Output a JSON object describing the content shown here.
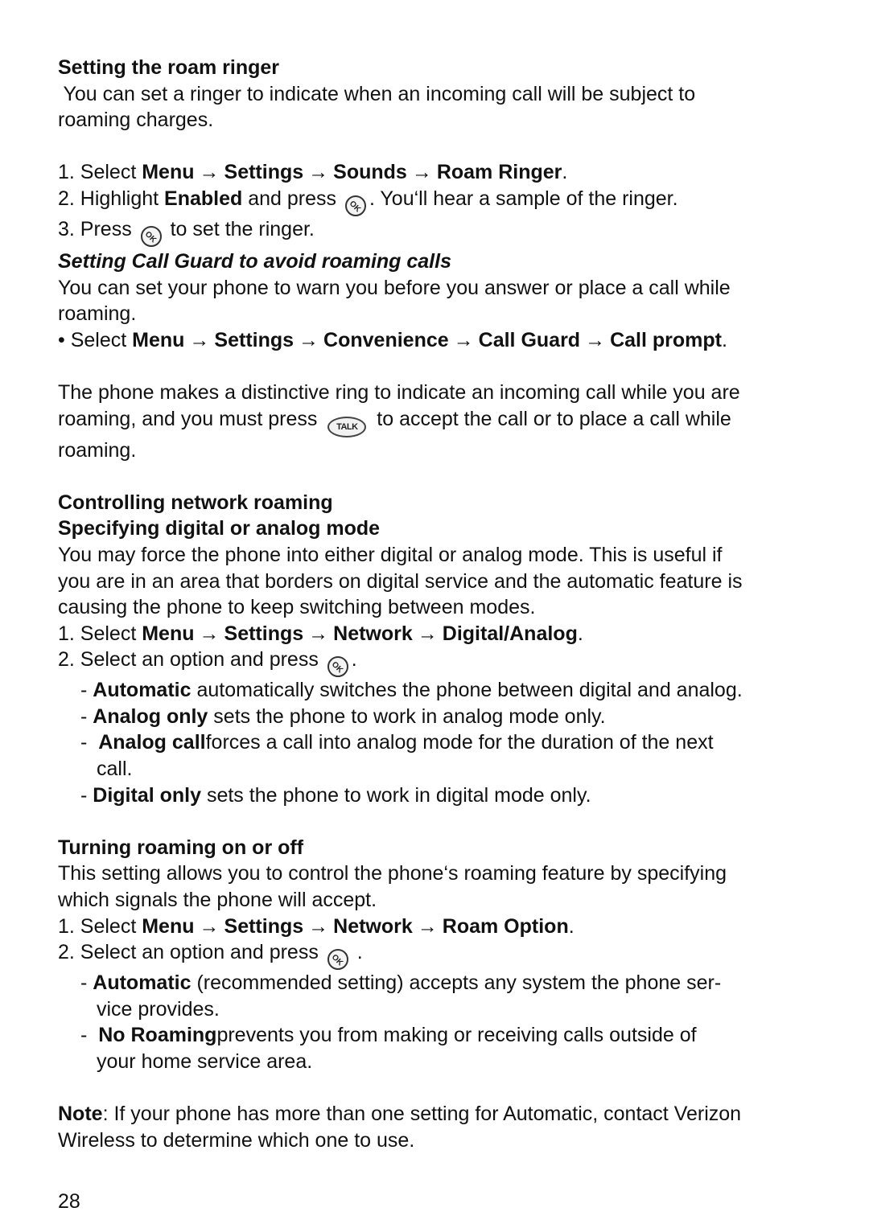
{
  "section1": {
    "heading": "Setting the roam ringer",
    "intro_1": " You can set a ringer to indicate when an incoming call will be subject to",
    "intro_2": "roaming charges.",
    "step1_prefix": "1. Select ",
    "step1_path": [
      "Menu",
      "Settings",
      "Sounds",
      "Roam Ringer"
    ],
    "step1_suffix": ".",
    "step2_prefix": "2. Highlight ",
    "step2_bold": "Enabled",
    "step2_mid": " and press ",
    "step2_suffix": ". You‘ll hear a sample of the ringer.",
    "step3_prefix": "3. Press ",
    "step3_suffix": " to set the ringer."
  },
  "section2": {
    "heading": "Setting Call Guard to avoid roaming calls",
    "intro_1": "You can set your phone to warn you before you answer or place a call while",
    "intro_2": "roaming.",
    "bullet_prefix": "• Select ",
    "bullet_path": [
      "Menu",
      "Settings",
      "Convenience",
      "Call Guard",
      "Call prompt"
    ],
    "bullet_suffix": ".",
    "para_1": "The phone makes a distinctive ring to indicate an incoming call while you are",
    "para_2_prefix": "roaming, and you must press ",
    "para_2_suffix": " to accept the call or to place a call while",
    "para_3": "roaming."
  },
  "section3": {
    "heading": "Controlling network roaming",
    "subheading": "Specifying digital or analog mode",
    "intro_1": "You may force the phone into either digital or analog mode. This is useful if",
    "intro_2": "you are in an area that borders on digital service and the automatic feature is",
    "intro_3": "causing the phone to keep switching between modes.",
    "step1_prefix": "1. Select ",
    "step1_path": [
      "Menu",
      "Settings",
      "Network",
      "Digital/Analog"
    ],
    "step1_suffix": ".",
    "step2_prefix": "2. Select an option and press ",
    "step2_suffix": ".",
    "options": [
      {
        "dash": "- ",
        "bold": "Automatic",
        "text": " automatically switches the phone between digital and analog."
      },
      {
        "dash": "- ",
        "bold": "Analog only",
        "text": " sets the phone to work in analog mode only."
      },
      {
        "dash": "-  ",
        "bold": "Analog call",
        "text": "forces a call into analog mode for the duration of the next",
        "cont": "call."
      },
      {
        "dash": "- ",
        "bold": "Digital only",
        "text": " sets the phone to work in digital mode only."
      }
    ]
  },
  "section4": {
    "heading": "Turning roaming on or off",
    "intro_1": "This setting allows you to control the phone‘s roaming feature by specifying",
    "intro_2": "which signals the phone will accept.",
    "step1_prefix": "1. Select ",
    "step1_path": [
      "Menu",
      "Settings",
      "Network",
      "Roam Option"
    ],
    "step1_suffix": ".",
    "step2_prefix": "2. Select an option and press ",
    "step2_suffix": " .",
    "options": [
      {
        "dash": "- ",
        "bold": "Automatic",
        "text": " (recommended setting) accepts any system the phone ser-",
        "cont": "vice provides."
      },
      {
        "dash": "-  ",
        "bold": "No Roaming",
        "text": "prevents you from making or receiving calls outside of",
        "cont": "your home service area."
      }
    ]
  },
  "note": {
    "label": "Note",
    "text_1": ": If your phone has more than one setting for Automatic, contact Verizon",
    "text_2": "Wireless to determine which one to use."
  },
  "icons": {
    "ok_key": "OK",
    "talk_key": "TALK",
    "arrow": "→"
  },
  "page_number": "28"
}
